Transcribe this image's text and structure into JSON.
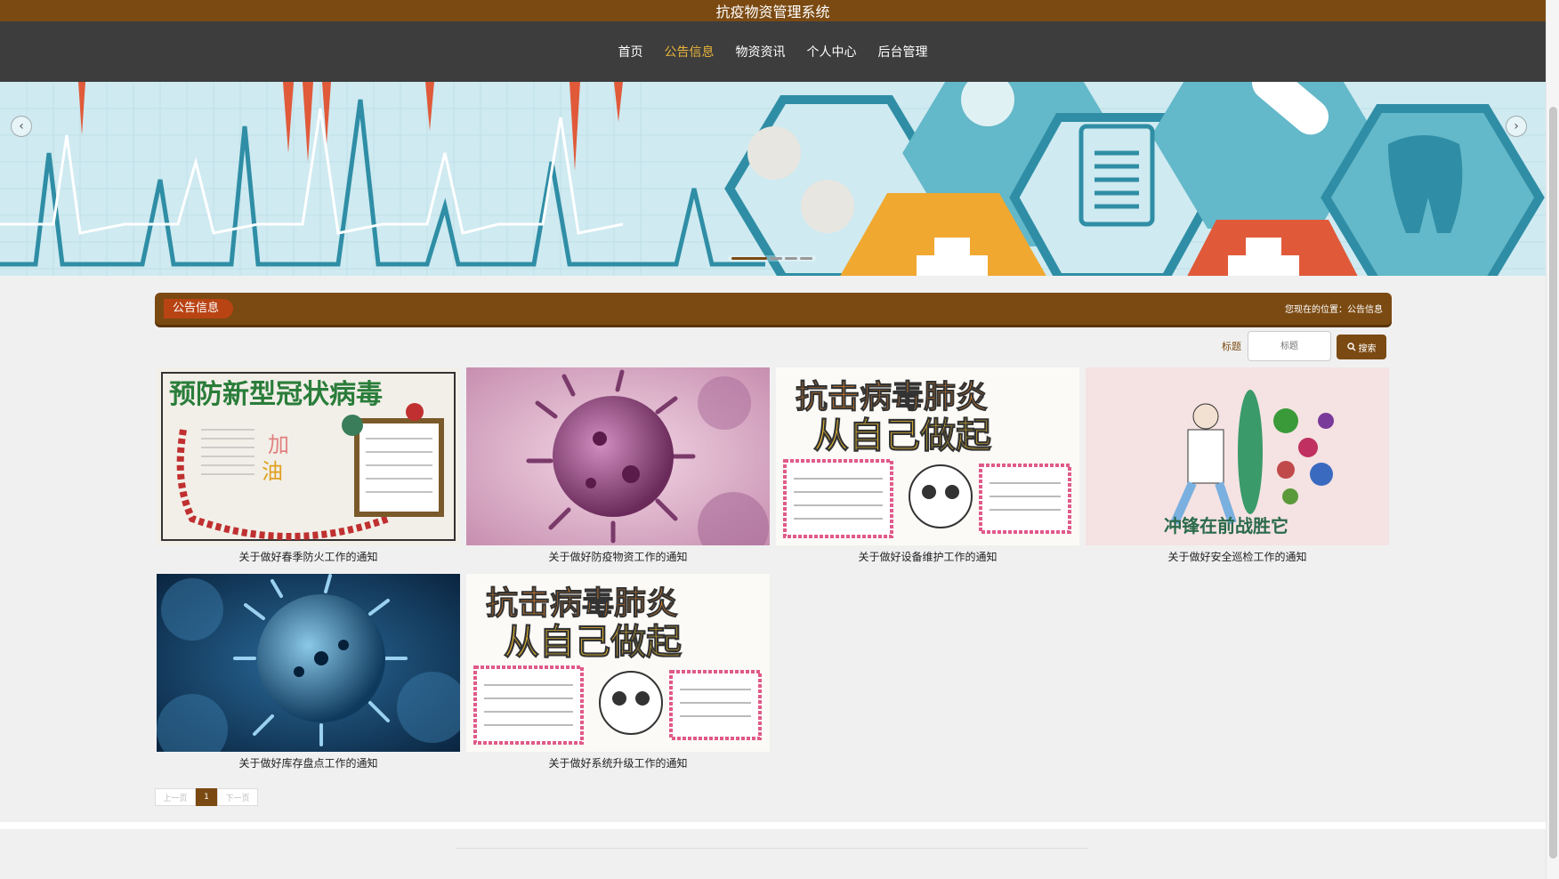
{
  "site": {
    "title": "抗疫物资管理系统"
  },
  "nav": [
    {
      "label": "首页",
      "active": false
    },
    {
      "label": "公告信息",
      "active": true
    },
    {
      "label": "物资资讯",
      "active": false
    },
    {
      "label": "个人中心",
      "active": false
    },
    {
      "label": "后台管理",
      "active": false
    }
  ],
  "banner": {
    "prev_icon": "chevron-left-icon",
    "next_icon": "chevron-right-icon",
    "slide_count": 4,
    "active_slide": 1
  },
  "section": {
    "tag": "公告信息",
    "breadcrumb": "您现在的位置：公告信息"
  },
  "search": {
    "label": "标题",
    "placeholder": "标题",
    "button_label": "搜索"
  },
  "notices": [
    {
      "title": "关于做好春季防火工作的通知",
      "image": "prevention-poster"
    },
    {
      "title": "关于做好防疫物资工作的通知",
      "image": "virus-purple"
    },
    {
      "title": "关于做好设备维护工作的通知",
      "image": "fight-poster"
    },
    {
      "title": "关于做好安全巡检工作的通知",
      "image": "doctor-shield"
    },
    {
      "title": "关于做好库存盘点工作的通知",
      "image": "virus-blue"
    },
    {
      "title": "关于做好系统升级工作的通知",
      "image": "fight-poster"
    }
  ],
  "pager": {
    "prev": "上一页",
    "current": "1",
    "next": "下一页"
  },
  "colors": {
    "brand": "#7b4a12",
    "nav_bg": "#3d3d3d",
    "active_nav": "#e8b43c",
    "tag": "#b84313"
  }
}
